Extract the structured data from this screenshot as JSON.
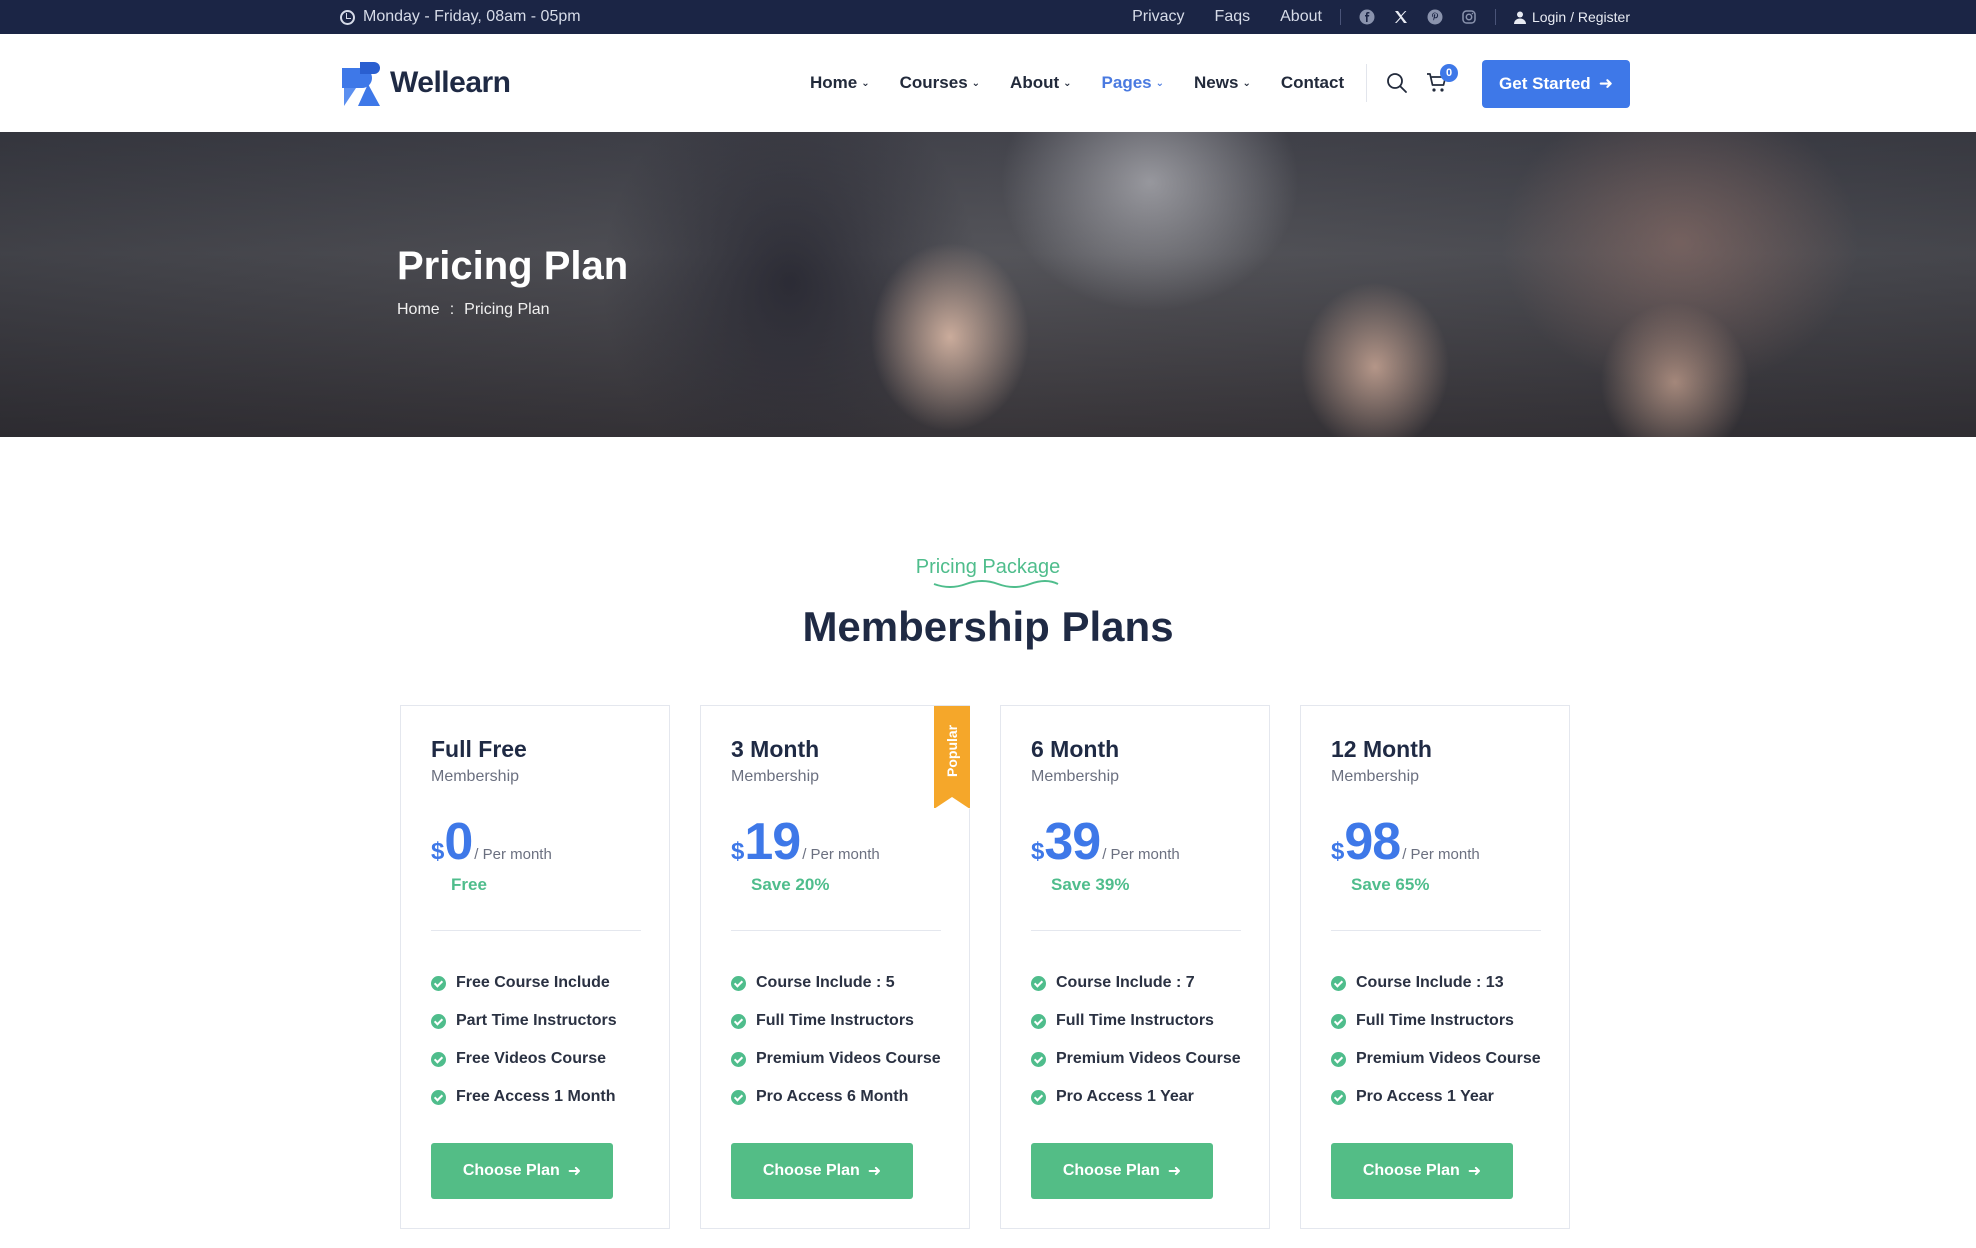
{
  "topbar": {
    "hours": "Monday - Friday, 08am - 05pm",
    "links": [
      "Privacy",
      "Faqs",
      "About"
    ],
    "social_icons": [
      "facebook-icon",
      "x-icon",
      "pinterest-icon",
      "instagram-icon"
    ],
    "login": "Login / Register"
  },
  "header": {
    "logo": "Wellearn",
    "nav": [
      {
        "label": "Home",
        "dropdown": true
      },
      {
        "label": "Courses",
        "dropdown": true
      },
      {
        "label": "About",
        "dropdown": true
      },
      {
        "label": "Pages",
        "dropdown": true,
        "active": true
      },
      {
        "label": "News",
        "dropdown": true
      },
      {
        "label": "Contact",
        "dropdown": false
      }
    ],
    "cart_count": "0",
    "cta": "Get Started"
  },
  "hero": {
    "title": "Pricing Plan",
    "breadcrumb": [
      "Home",
      ":",
      "Pricing Plan"
    ]
  },
  "section": {
    "subtitle": "Pricing Package",
    "title": "Membership Plans"
  },
  "plans": [
    {
      "name": "Full Free",
      "sub": "Membership",
      "currency": "$",
      "amount": "0",
      "per": "/ Per month",
      "save": "Free",
      "features": [
        "Free Course Include",
        "Part Time Instructors",
        "Free Videos Course",
        "Free Access 1 Month"
      ],
      "button": "Choose Plan"
    },
    {
      "name": "3 Month",
      "sub": "Membership",
      "currency": "$",
      "amount": "19",
      "per": "/ Per month",
      "save": "Save 20%",
      "features": [
        "Course Include : 5",
        "Full Time Instructors",
        "Premium Videos Course",
        "Pro Access 6 Month"
      ],
      "button": "Choose Plan",
      "badge": "Popular"
    },
    {
      "name": "6 Month",
      "sub": "Membership",
      "currency": "$",
      "amount": "39",
      "per": "/ Per month",
      "save": "Save 39%",
      "features": [
        "Course Include : 7",
        "Full Time Instructors",
        "Premium Videos Course",
        "Pro Access 1 Year"
      ],
      "button": "Choose Plan"
    },
    {
      "name": "12 Month",
      "sub": "Membership",
      "currency": "$",
      "amount": "98",
      "per": "/ Per month",
      "save": "Save 65%",
      "features": [
        "Course Include : 13",
        "Full Time Instructors",
        "Premium Videos Course",
        "Pro Access 1 Year"
      ],
      "button": "Choose Plan"
    }
  ],
  "colors": {
    "topbar_bg": "#1b2545",
    "brand_blue": "#3e78e8",
    "accent_green": "#53bd86",
    "badge_orange": "#f5a72a"
  }
}
